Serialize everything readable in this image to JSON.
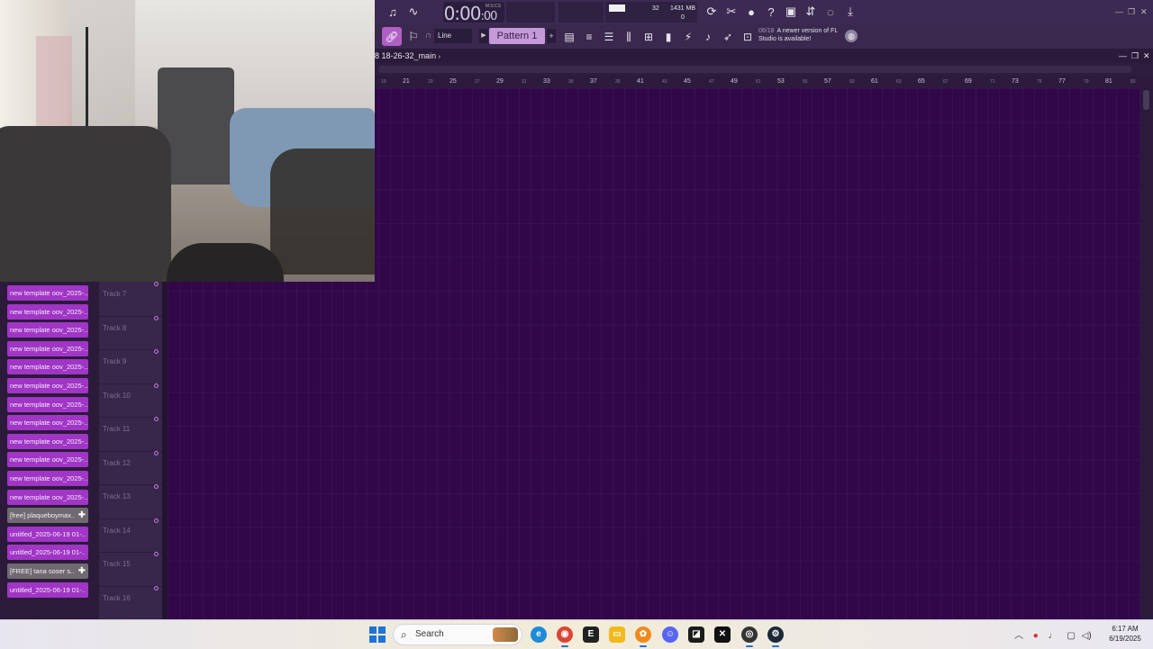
{
  "toolbar": {
    "time": "0:00",
    "time_sub": ":00",
    "time_unit": "M:S:CS",
    "monitor": {
      "polyphony": "32",
      "memory": "1431 MB",
      "zero": "0"
    },
    "snap": "Line",
    "pattern": "Pattern 1",
    "update_date": "06/18",
    "update_text": "A newer version of FL Studio is available!",
    "icons_row1": [
      "piano-icon",
      "wave-icon",
      "refresh-icon",
      "scissors-icon",
      "mic-icon",
      "help-icon",
      "save-icon",
      "render-icon",
      "chat-icon",
      "download-icon"
    ],
    "icons_row2": [
      "link-icon",
      "stamp-icon",
      "playlist-icon",
      "channel-rack-icon",
      "mixer-icon",
      "piano-roll-icon",
      "browser-icon",
      "plugin-icon",
      "tempo-icon",
      "touch-icon",
      "cart-icon"
    ]
  },
  "playlist": {
    "title_prefix": "8",
    "title": "18-26-32_main",
    "ruler_major": [
      "21",
      "25",
      "29",
      "33",
      "37",
      "41",
      "45",
      "49",
      "53",
      "57",
      "61",
      "65",
      "69",
      "73",
      "77",
      "81"
    ],
    "ruler_minor": [
      "19",
      "23",
      "27",
      "31",
      "35",
      "39",
      "43",
      "47",
      "51",
      "55",
      "59",
      "63",
      "67",
      "71",
      "75",
      "79",
      "83"
    ],
    "tracks": [
      "Track 7",
      "Track 8",
      "Track 9",
      "Track 10",
      "Track 11",
      "Track 12",
      "Track 13",
      "Track 14",
      "Track 15",
      "Track 16"
    ]
  },
  "picker": {
    "items": [
      {
        "label": "new template oov_2025-..",
        "type": "pattern"
      },
      {
        "label": "new template oov_2025-..",
        "type": "pattern"
      },
      {
        "label": "new template oov_2025-..",
        "type": "pattern"
      },
      {
        "label": "new template oov_2025-..",
        "type": "pattern"
      },
      {
        "label": "new template oov_2025-..",
        "type": "pattern"
      },
      {
        "label": "new template oov_2025-..",
        "type": "pattern"
      },
      {
        "label": "new template oov_2025-..",
        "type": "pattern"
      },
      {
        "label": "new template oov_2025-..",
        "type": "pattern"
      },
      {
        "label": "new template oov_2025-..",
        "type": "pattern"
      },
      {
        "label": "new template oov_2025-..",
        "type": "pattern"
      },
      {
        "label": "new template oov_2025-..",
        "type": "pattern"
      },
      {
        "label": "new template oov_2025-..",
        "type": "pattern"
      },
      {
        "label": "[free] plaqueboymax..",
        "type": "audio"
      },
      {
        "label": "untitled_2025-06-19 01-..",
        "type": "pattern"
      },
      {
        "label": "untitled_2025-06-19 01-..",
        "type": "pattern"
      },
      {
        "label": "[FREE] tana  soser s..",
        "type": "audio"
      },
      {
        "label": "untitled_2025-06-19 01-..",
        "type": "pattern"
      }
    ]
  },
  "taskbar": {
    "search_placeholder": "Search",
    "time": "6:17 AM",
    "date": "6/19/2025",
    "apps": [
      "edge-icon",
      "chrome-icon",
      "epic-games-icon",
      "file-explorer-icon",
      "fl-studio-icon",
      "discord-icon",
      "capcut-icon",
      "x-app-icon",
      "obs-icon",
      "steam-icon"
    ]
  },
  "colors": {
    "accent": "#a035c6",
    "grid": "#31074a",
    "toolbar": "#3c2a52"
  }
}
